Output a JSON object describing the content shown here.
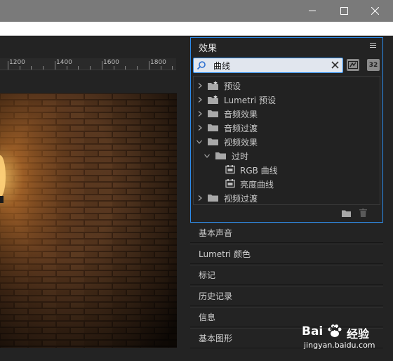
{
  "effects_panel": {
    "title": "效果",
    "search": {
      "value": "曲线",
      "placeholder": ""
    },
    "toolbar": {
      "accel_label": "",
      "bit32_label": "32"
    },
    "tree": [
      {
        "label": "预设",
        "icon": "preset-folder-icon",
        "expanded": false,
        "level": 0
      },
      {
        "label": "Lumetri 预设",
        "icon": "preset-folder-icon",
        "expanded": false,
        "level": 0
      },
      {
        "label": "音频效果",
        "icon": "folder-icon",
        "expanded": false,
        "level": 0
      },
      {
        "label": "音频过渡",
        "icon": "folder-icon",
        "expanded": false,
        "level": 0
      },
      {
        "label": "视频效果",
        "icon": "folder-icon",
        "expanded": true,
        "level": 0
      },
      {
        "label": "过时",
        "icon": "folder-icon",
        "expanded": true,
        "level": 1
      },
      {
        "label": "RGB 曲线",
        "icon": "effect-icon",
        "level": 2
      },
      {
        "label": "亮度曲线",
        "icon": "effect-icon",
        "level": 2
      },
      {
        "label": "视频过渡",
        "icon": "folder-icon",
        "expanded": false,
        "level": 0
      }
    ]
  },
  "panels": [
    "基本声音",
    "Lumetri 颜色",
    "标记",
    "历史记录",
    "信息",
    "基本图形"
  ],
  "ruler": {
    "labels": [
      "1200",
      "1400",
      "1600",
      "1800"
    ]
  },
  "watermark": {
    "brand_left": "Bai",
    "brand_mid": "du",
    "brand_right": "经验",
    "url": "jingyan.baidu.com"
  },
  "colors": {
    "focus_border": "#2d8ceb",
    "title_bar": "#7a7a7a",
    "panel_bg": "#232323"
  }
}
